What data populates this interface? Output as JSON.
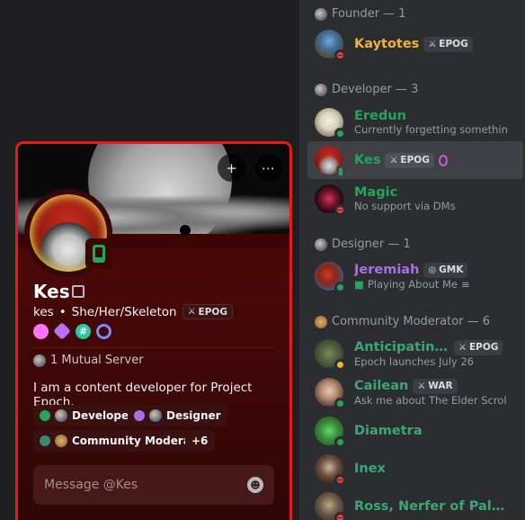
{
  "groups": [
    {
      "title": "Founder — 1"
    },
    {
      "title": "Developer — 3"
    },
    {
      "title": "Designer — 1"
    },
    {
      "title": "Community Moderator — 6"
    }
  ],
  "members": [
    {
      "name": "Kaytotes",
      "color": "#f0b232",
      "tag": "EPOG",
      "status": ""
    },
    {
      "name": "Eredun",
      "color": "#23a55a",
      "tag": "",
      "status": "Currently forgetting something"
    },
    {
      "name": "Kes",
      "color": "#23a55a",
      "tag": "EPOG",
      "status": ""
    },
    {
      "name": "Magic",
      "color": "#23a55a",
      "tag": "",
      "status": "No support via DMs"
    },
    {
      "name": "Jeremiah",
      "color": "#a970e6",
      "tag": "GMK",
      "status": "Playing About Me"
    },
    {
      "name": "Anticipating ...",
      "color": "#3aa774",
      "tag": "EPOG",
      "status": "Epoch launches July 26"
    },
    {
      "name": "Cailean",
      "color": "#3aa774",
      "tag": "WAR",
      "status": "Ask me about The Elder Scrol..."
    },
    {
      "name": "Diametra",
      "color": "#3aa774",
      "tag": "",
      "status": ""
    },
    {
      "name": "Inex",
      "color": "#3aa774",
      "tag": "",
      "status": ""
    },
    {
      "name": "Ross, Nerfer of Paladi...",
      "color": "#3aa774",
      "tag": "",
      "status": ""
    }
  ],
  "profile": {
    "display_name": "Kes",
    "username": "kes",
    "bullet": "•",
    "pronouns": "She/Her/Skeleton",
    "tag": "EPOG",
    "mutual": "1 Mutual Server",
    "bio": "I am a content developer for Project Epoch.",
    "roles": [
      {
        "label": "Developer",
        "color": "#23a55a"
      },
      {
        "label": "Designer",
        "color": "#a970e6"
      },
      {
        "label": "Community Moderator",
        "color": "#3a8a73"
      }
    ],
    "more_roles": "+6",
    "message_placeholder": "Message @Kes",
    "badges": [
      "boost-badge",
      "nitro-gem-badge",
      "hashtag-badge",
      "quest-badge"
    ],
    "badge_glyphs": {
      "hashtag": "#"
    },
    "more_glyph": "⋯",
    "add_friend_glyph": "+",
    "emoji_glyph": "☻"
  },
  "colors": {
    "popout_border": "#e31b1b",
    "online": "#23a55a",
    "dnd": "#f23f43"
  }
}
